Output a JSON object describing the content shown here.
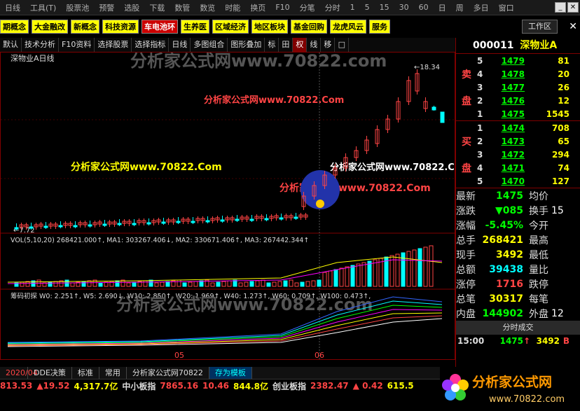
{
  "menu": [
    "日线",
    "工具(T)",
    "股票池",
    "预警",
    "选股",
    "下载",
    "数管",
    "数览",
    "时能",
    "换页",
    "F10",
    "分笔",
    "分时",
    "1",
    "5",
    "15",
    "30",
    "60",
    "日",
    "周",
    "多日",
    "窗口"
  ],
  "categories": [
    {
      "label": "期概念",
      "red": false
    },
    {
      "label": "大金融改",
      "red": false
    },
    {
      "label": "新概念",
      "red": false
    },
    {
      "label": "科技资源",
      "red": false
    },
    {
      "label": "车电池环",
      "red": true
    },
    {
      "label": "生养医",
      "red": false
    },
    {
      "label": "区域经济",
      "red": false
    },
    {
      "label": "地区板块",
      "red": false
    },
    {
      "label": "基金回购",
      "red": false
    },
    {
      "label": "龙虎风云",
      "red": false
    },
    {
      "label": "服务",
      "red": false
    }
  ],
  "workzone_label": "工作区",
  "toolbar": [
    "默认",
    "技术分析",
    "F10资料",
    "选择股票",
    "选择指标",
    "日线",
    "多图组合",
    "图形叠加",
    "标",
    "田",
    "权",
    "线",
    "移",
    "□"
  ],
  "chart": {
    "title": "深物业A日线",
    "high_label": "←18.34",
    "low_label": "←7.72",
    "vol_legend": "VOL(5,10,20)  268421.000↑, MA1: 303267.406↓, MA2: 330671.406↑, MA3: 267442.344↑",
    "chip_legend": "筹码初探  W0: 2.251↑, W5: 2.690↓, W10: 2.850↑, W20: 1.969↑, W40: 1.273↑, W60: 0.709↑, W100: 0.473↑,",
    "date_labels": [
      "2020/04",
      "05",
      "06"
    ],
    "watermarks": [
      "分析家公式网www.70822.com",
      "分析家公式网www.70822.Com",
      "分析家公式网www.70822.Com",
      "分析家公式网www.70822.Com",
      "分析家公式网www.70822.Com",
      "分析家公式网www.70822.com"
    ]
  },
  "stock": {
    "code": "000011",
    "name": "深物业A"
  },
  "sell": [
    {
      "lvl": "5",
      "price": "1479",
      "vol": "81"
    },
    {
      "lvl": "4",
      "price": "1478",
      "vol": "20"
    },
    {
      "lvl": "3",
      "price": "1477",
      "vol": "26"
    },
    {
      "lvl": "2",
      "price": "1476",
      "vol": "12"
    },
    {
      "lvl": "1",
      "price": "1475",
      "vol": "1545"
    }
  ],
  "buy": [
    {
      "lvl": "1",
      "price": "1474",
      "vol": "708"
    },
    {
      "lvl": "2",
      "price": "1473",
      "vol": "65"
    },
    {
      "lvl": "3",
      "price": "1472",
      "vol": "294"
    },
    {
      "lvl": "4",
      "price": "1471",
      "vol": "74"
    },
    {
      "lvl": "5",
      "price": "1470",
      "vol": "127"
    }
  ],
  "sell_side_label": [
    "卖",
    "盘"
  ],
  "buy_side_label": [
    "买",
    "盘"
  ],
  "quote": [
    {
      "l": "最新",
      "v": "1475",
      "c": "#00ff00",
      "l2": "均价",
      "v2": ""
    },
    {
      "l": "涨跌",
      "v": "▼085",
      "c": "#00ff00",
      "l2": "换手",
      "v2": "15"
    },
    {
      "l": "涨幅",
      "v": "-5.45%",
      "c": "#00ff00",
      "l2": "今开",
      "v2": ""
    },
    {
      "l": "总手",
      "v": "268421",
      "c": "#ffff00",
      "l2": "最高",
      "v2": ""
    },
    {
      "l": "现手",
      "v": "3492",
      "c": "#ffff00",
      "l2": "最低",
      "v2": ""
    },
    {
      "l": "总额",
      "v": "39438",
      "c": "#00ffff",
      "l2": "量比",
      "v2": ""
    },
    {
      "l": "涨停",
      "v": "1716",
      "c": "#ff4444",
      "l2": "跌停",
      "v2": ""
    },
    {
      "l": "总笔",
      "v": "30317",
      "c": "#ffff00",
      "l2": "每笔",
      "v2": ""
    },
    {
      "l": "内盘",
      "v": "144902",
      "c": "#00ff00",
      "l2": "外盘",
      "v2": "12"
    }
  ],
  "tick_title": "分时成交",
  "tick": {
    "time": "15:00",
    "price": "1475",
    "vol": "3492",
    "flag": "B"
  },
  "tabs": [
    "DDE决策",
    "标准",
    "常用",
    "分析家公式网70822",
    "存为模板"
  ],
  "status": [
    [
      "813.53",
      "▲19.52",
      "4,317.7亿",
      "中小板指",
      "7865.16",
      "10.46",
      "844.8亿",
      "创业板指",
      "2382.47",
      "▲ 0.42",
      "615.5"
    ],
    [
      ""
    ]
  ],
  "logo": {
    "text": "分析家公式网",
    "url": "www.70822.com"
  }
}
